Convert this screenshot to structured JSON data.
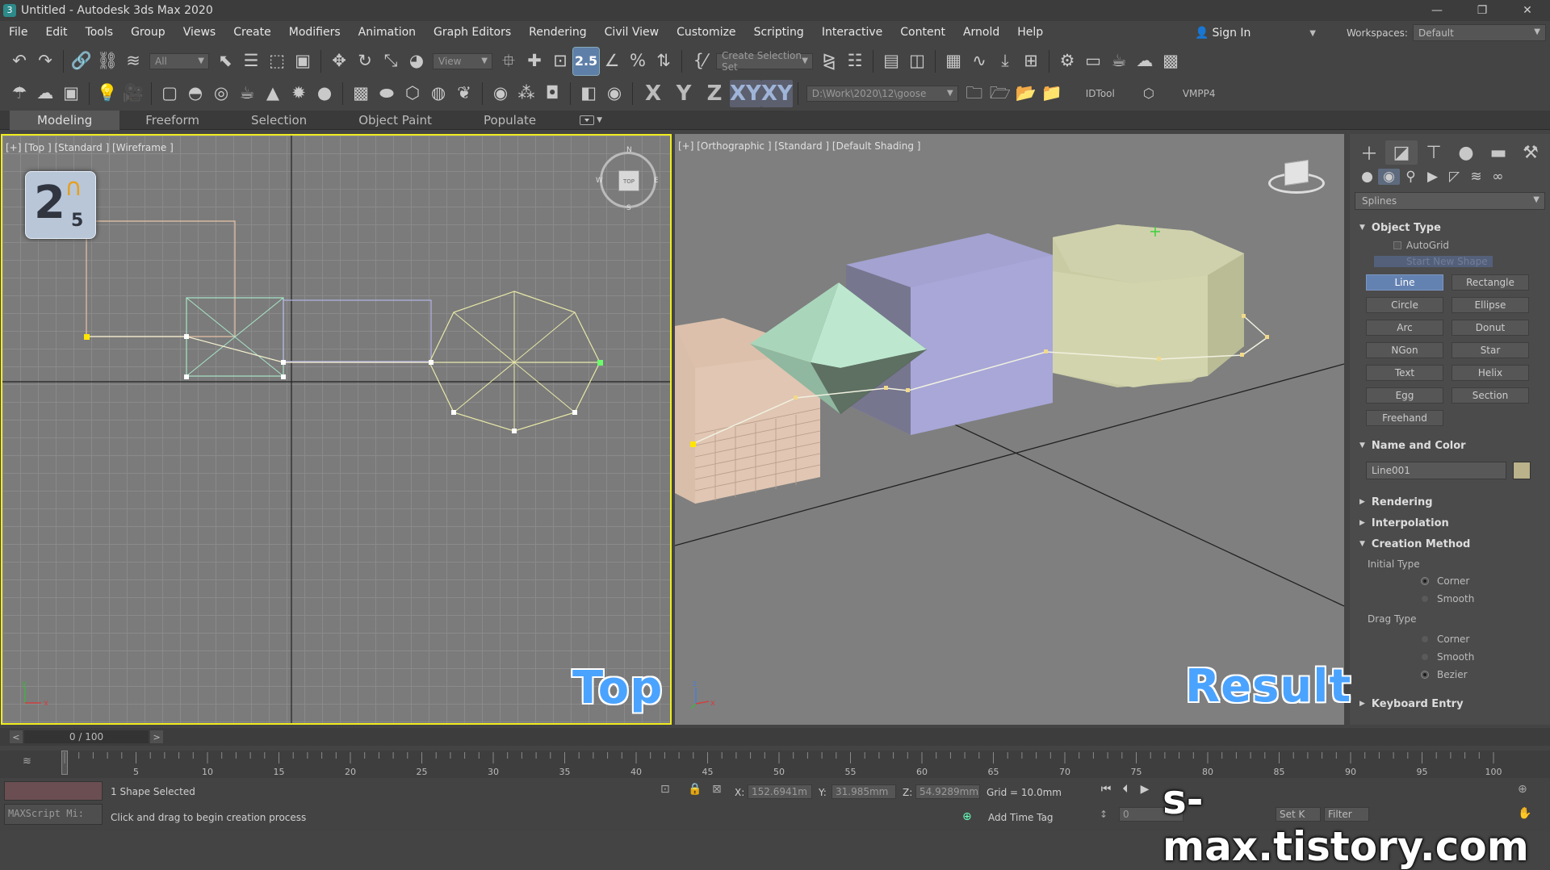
{
  "window": {
    "title": "Untitled - Autodesk 3ds Max 2020",
    "min": "—",
    "restore": "❐",
    "close": "✕"
  },
  "menu": [
    "File",
    "Edit",
    "Tools",
    "Group",
    "Views",
    "Create",
    "Modifiers",
    "Animation",
    "Graph Editors",
    "Rendering",
    "Civil View",
    "Customize",
    "Scripting",
    "Interactive",
    "Content",
    "Arnold",
    "Help"
  ],
  "account": {
    "signin": "Sign In",
    "workspaces_label": "Workspaces:",
    "workspace_value": "Default"
  },
  "toolbar": {
    "selection_filter": "All",
    "ref_coord": "View",
    "named_selection": "Create Selection Set",
    "axis_x": "X",
    "axis_y": "Y",
    "axis_z": "Z",
    "axis_xy": "XY",
    "axis_xy2": "XY",
    "project_path": "D:\\Work\\2020\\12\\goose",
    "idtool": "IDTool",
    "vmpp": "VMPP4"
  },
  "ribbon": {
    "tabs": [
      "Modeling",
      "Freeform",
      "Selection",
      "Object Paint",
      "Populate"
    ]
  },
  "viewports": {
    "top": {
      "label": "[+] [Top ] [Standard ] [Wireframe ]",
      "caption": "Top",
      "badge_main": "2",
      "badge_sub": "5",
      "viewcube": "TOP",
      "compass": {
        "n": "N",
        "s": "S",
        "e": "E",
        "w": "W"
      }
    },
    "result": {
      "label": "[+] [Orthographic ] [Standard ] [Default Shading ]",
      "caption": "Result"
    }
  },
  "command_panel": {
    "category": "Splines",
    "object_type": {
      "title": "Object Type",
      "autogrid": "AutoGrid",
      "start_new_shape": "Start New Shape",
      "buttons": [
        "Line",
        "Rectangle",
        "Circle",
        "Ellipse",
        "Arc",
        "Donut",
        "NGon",
        "Star",
        "Text",
        "Helix",
        "Egg",
        "Section",
        "Freehand"
      ]
    },
    "name_color": {
      "title": "Name and Color",
      "name": "Line001",
      "color": "#b9b28a"
    },
    "rendering": "Rendering",
    "interpolation": "Interpolation",
    "creation_method": {
      "title": "Creation Method",
      "initial_type": "Initial Type",
      "initial_options": [
        "Corner",
        "Smooth"
      ],
      "drag_type": "Drag Type",
      "drag_options": [
        "Corner",
        "Smooth",
        "Bezier"
      ]
    },
    "keyboard_entry": "Keyboard Entry"
  },
  "timeline": {
    "frame": "0 / 100",
    "ticks": [
      "5",
      "10",
      "15",
      "20",
      "25",
      "30",
      "35",
      "40",
      "45",
      "50",
      "55",
      "60",
      "65",
      "70",
      "75",
      "80",
      "85",
      "90",
      "95",
      "100"
    ]
  },
  "status": {
    "maxscript": "MAXScript Mi:",
    "selection": "1 Shape Selected",
    "prompt": "Click and drag to begin creation process",
    "x_label": "X:",
    "x_value": "152.6941m",
    "y_label": "Y:",
    "y_value": "31.985mm",
    "z_label": "Z:",
    "z_value": "54.9289mm",
    "grid": "Grid = 10.0mm",
    "add_time_tag": "Add Time Tag",
    "frame_field": "0",
    "set_key": "Set K",
    "filters": "Filter"
  },
  "watermark": "s-max.tistory.com",
  "colors": {
    "accent": "#f0ec1e",
    "caption": "#4aa3ff",
    "selected": "#6482b1"
  }
}
